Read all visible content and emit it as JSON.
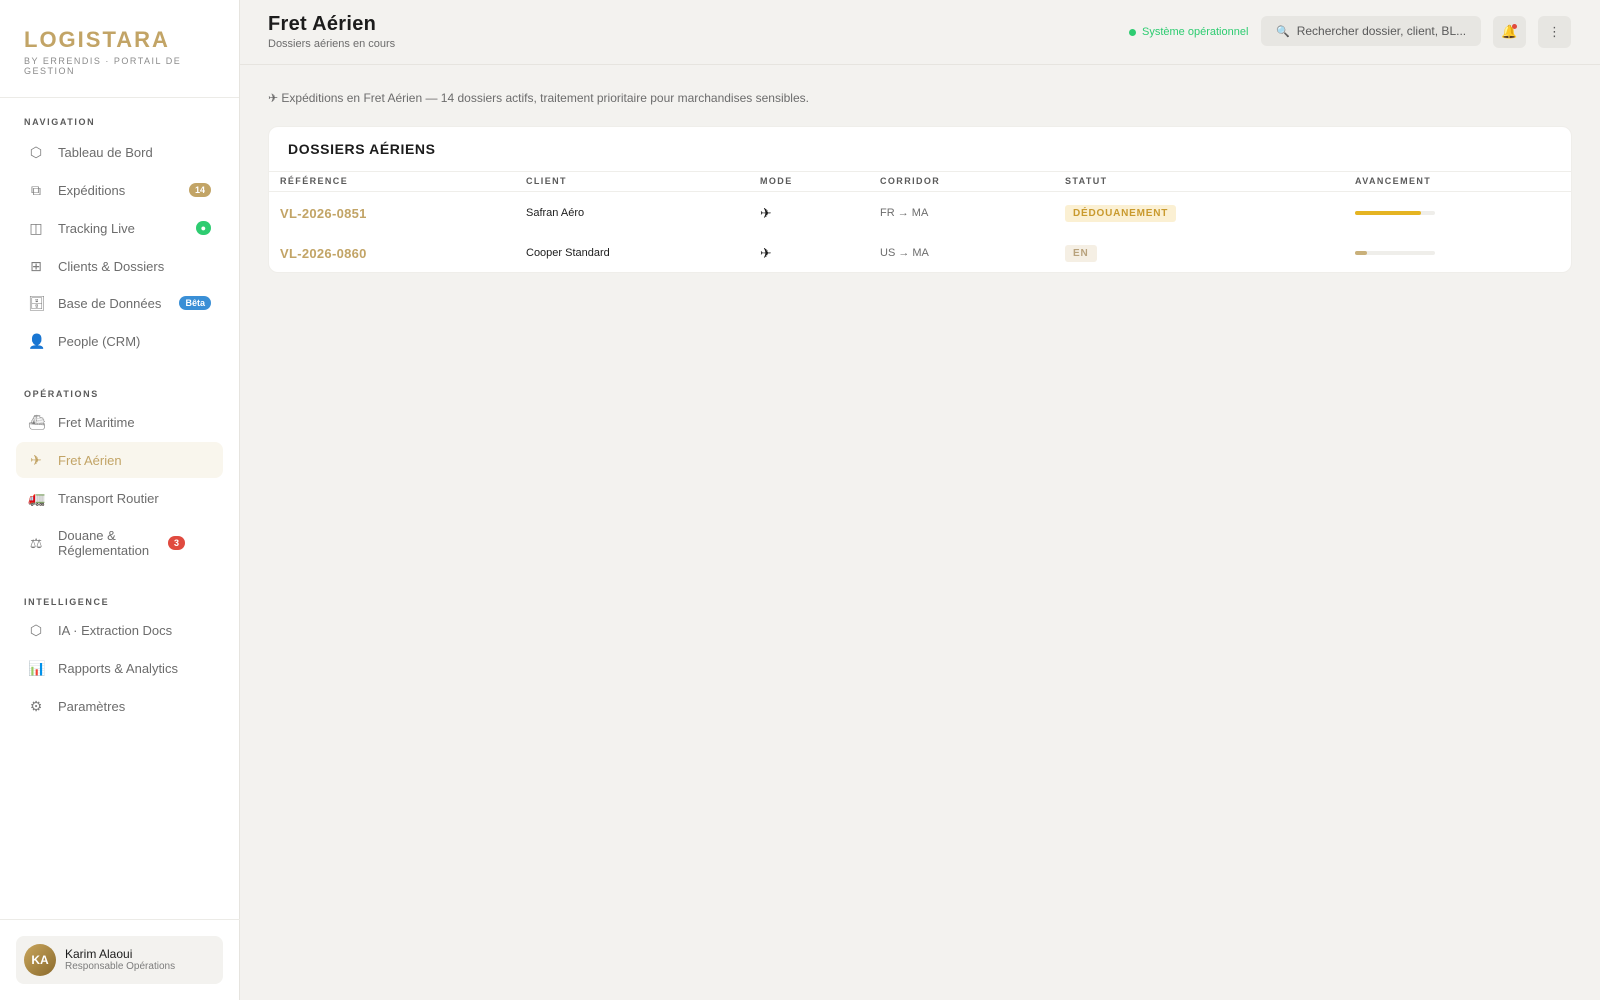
{
  "brand": {
    "name": "LOGISTARA",
    "tagline": "BY ERRENDIS · PORTAIL DE GESTION"
  },
  "sidebar": {
    "sections": [
      {
        "title": "NAVIGATION",
        "items": [
          {
            "label": "Tableau de Bord",
            "icon": "cube-icon"
          },
          {
            "label": "Expéditions",
            "icon": "copy-icon",
            "badge": "14"
          },
          {
            "label": "Tracking Live",
            "icon": "map-icon",
            "badge": "●"
          },
          {
            "label": "Clients & Dossiers",
            "icon": "grid-icon"
          },
          {
            "label": "Base de Données",
            "icon": "database-icon",
            "badge": "Bêta"
          },
          {
            "label": "People (CRM)",
            "icon": "person-icon"
          }
        ]
      },
      {
        "title": "OPÉRATIONS",
        "items": [
          {
            "label": "Fret Maritime",
            "icon": "ship-icon"
          },
          {
            "label": "Fret Aérien",
            "icon": "plane-icon",
            "active": true
          },
          {
            "label": "Transport Routier",
            "icon": "truck-icon"
          },
          {
            "label": "Douane & Réglementation",
            "icon": "scale-icon",
            "badge": "3"
          }
        ]
      },
      {
        "title": "INTELLIGENCE",
        "items": [
          {
            "label": "IA · Extraction Docs",
            "icon": "hexagon-icon"
          },
          {
            "label": "Rapports & Analytics",
            "icon": "bar-chart-icon"
          },
          {
            "label": "Paramètres",
            "icon": "gear-icon"
          }
        ]
      }
    ]
  },
  "user": {
    "initials": "KA",
    "name": "Karim Alaoui",
    "role": "Responsable Opérations"
  },
  "header": {
    "title": "Fret Aérien",
    "subtitle": "Dossiers aériens en cours",
    "status": "Système opérationnel",
    "search_placeholder": "Rechercher dossier, client, BL...",
    "search_icon": "magnifier-icon",
    "notif_icon": "bell-icon",
    "menu_icon": "more-vertical-icon"
  },
  "info": "✈ Expéditions en Fret Aérien — 14 dossiers actifs, traitement prioritaire pour marchandises sensibles.",
  "table": {
    "title": "DOSSIERS AÉRIENS",
    "columns": [
      "RÉFÉRENCE",
      "CLIENT",
      "MODE",
      "CORRIDOR",
      "STATUT",
      "AVANCEMENT"
    ],
    "rows": [
      {
        "ref": "VL-2026-0851",
        "client": "Safran Aéro",
        "mode": "✈",
        "corridor": "FR → MA",
        "status": "DÉDOUANEMENT",
        "progress": 0.82
      },
      {
        "ref": "VL-2026-0860",
        "client": "Cooper Standard",
        "mode": "✈",
        "corridor": "US → MA",
        "status": "EN",
        "progress": 0.15
      }
    ]
  },
  "colors": {
    "accent": "#c2a466",
    "success": "#2ecc71",
    "danger": "#e04a3f",
    "info": "#3a8fd6",
    "progress_gold": "#e5b422"
  }
}
